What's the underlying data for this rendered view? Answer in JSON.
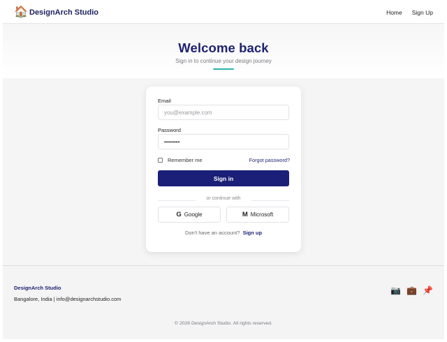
{
  "nav": {
    "logo_icon": "🏠",
    "brand": "DesignArch Studio",
    "links": [
      {
        "label": "Home"
      },
      {
        "label": "Sign Up"
      }
    ]
  },
  "hero": {
    "title": "Welcome back",
    "subtitle": "Sign in to continue your design journey",
    "accent_color": "#2bb3b0"
  },
  "form": {
    "email_label": "Email",
    "email_placeholder": "you@example.com",
    "email_value": "",
    "password_label": "Password",
    "password_value": "••••••••",
    "remember_label": "Remember me",
    "remember_checked": false,
    "forgot_label": "Forgot password?",
    "submit_label": "Sign in",
    "submit_color": "#1b1f77",
    "divider_text": "or continue with",
    "social": [
      {
        "glyph": "G",
        "label": "Google",
        "icon": "google-icon"
      },
      {
        "glyph": "M",
        "label": "Microsoft",
        "icon": "microsoft-icon"
      }
    ],
    "signup_prompt": "Don't have an account?",
    "signup_link": "Sign up"
  },
  "footer": {
    "brand": "DesignArch Studio",
    "contact": "Bangalore, India | info@designarchstudio.com",
    "icons": [
      {
        "glyph": "📷",
        "name": "camera-icon"
      },
      {
        "glyph": "💼",
        "name": "briefcase-icon"
      },
      {
        "glyph": "📌",
        "name": "pushpin-icon"
      }
    ],
    "copyright": "© 2026 DesignArch Studio. All rights reserved."
  }
}
